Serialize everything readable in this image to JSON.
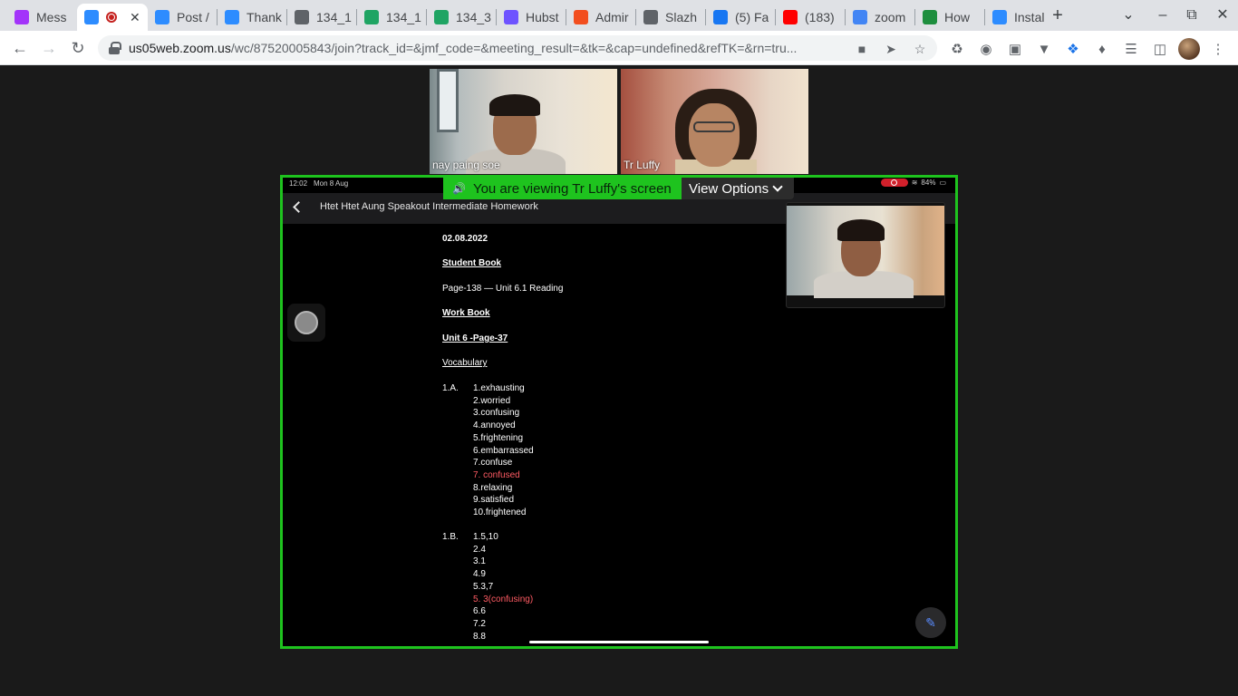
{
  "browser": {
    "tabs": [
      {
        "title": "Mess",
        "icon": "messenger-icon",
        "color": "#a334fa"
      },
      {
        "title": "",
        "icon": "zoom-icon",
        "color": "#2d8cff",
        "active": true,
        "recording": true
      },
      {
        "title": "Post /",
        "icon": "zoom-icon",
        "color": "#2d8cff"
      },
      {
        "title": "Thank",
        "icon": "zoom-icon",
        "color": "#2d8cff"
      },
      {
        "title": "134_1",
        "icon": "globe-icon",
        "color": "#5f6368"
      },
      {
        "title": "134_1",
        "icon": "google-drive-icon",
        "color": "#1fa463"
      },
      {
        "title": "134_3",
        "icon": "google-drive-icon",
        "color": "#1fa463"
      },
      {
        "title": "Hubst",
        "icon": "hubstaff-icon",
        "color": "#6e53ff"
      },
      {
        "title": "Admir",
        "icon": "figma-icon",
        "color": "#f24e1e"
      },
      {
        "title": "Slazh",
        "icon": "globe-icon",
        "color": "#5f6368"
      },
      {
        "title": "(5) Fa",
        "icon": "facebook-icon",
        "color": "#1877f2"
      },
      {
        "title": "(183)",
        "icon": "youtube-icon",
        "color": "#ff0000"
      },
      {
        "title": "zoom",
        "icon": "google-icon",
        "color": "#4285f4"
      },
      {
        "title": "How",
        "icon": "link-icon",
        "color": "#1e8e3e"
      },
      {
        "title": "Instal",
        "icon": "zoom-icon",
        "color": "#2d8cff"
      }
    ],
    "new_tab": "+",
    "url_host": "us05web.zoom.us",
    "url_path": "/wc/87520005843/join?track_id=&jmf_code=&meeting_result=&tk=&cap=undefined&refTK=&rn=tru..."
  },
  "meeting": {
    "participants": [
      {
        "name": "nay paing soe"
      },
      {
        "name": "Tr Luffy"
      }
    ],
    "share_banner": "You are viewing Tr Luffy's screen",
    "view_options": "View Options"
  },
  "shared_screen": {
    "status_time": "12:02",
    "status_date": "Mon 8 Aug",
    "battery": "84%",
    "doc_title": "Htet Htet Aung Speakout Intermediate Homework",
    "doc": {
      "date": "02.08.2022",
      "student_book": "Student Book",
      "page_line": "Page-138 — Unit 6.1 Reading",
      "work_book": "Work Book",
      "unit_line": "Unit 6 -Page-37",
      "vocab": "Vocabulary",
      "label_1a": "1.A.",
      "items_1a": [
        {
          "text": "1.exhausting",
          "red": false
        },
        {
          "text": "2.worried",
          "red": false
        },
        {
          "text": "3.confusing",
          "red": false
        },
        {
          "text": "4.annoyed",
          "red": false
        },
        {
          "text": "5.frightening",
          "red": false
        },
        {
          "text": "6.embarrassed",
          "red": false
        },
        {
          "text": "7.confuse",
          "red": false
        },
        {
          "text": "7. confused",
          "red": true
        },
        {
          "text": "8.relaxing",
          "red": false
        },
        {
          "text": "9.satisfied",
          "red": false
        },
        {
          "text": "10.frightened",
          "red": false
        }
      ],
      "label_1b": "1.B.",
      "items_1b": [
        {
          "text": "1.5,10",
          "red": false
        },
        {
          "text": "2.4",
          "red": false
        },
        {
          "text": "3.1",
          "red": false
        },
        {
          "text": "4.9",
          "red": false
        },
        {
          "text": "5.3,7",
          "red": false
        },
        {
          "text": "5. 3(confusing)",
          "red": true
        },
        {
          "text": "6.6",
          "red": false
        },
        {
          "text": "7.2",
          "red": false
        },
        {
          "text": "8.8",
          "red": false
        }
      ]
    }
  }
}
